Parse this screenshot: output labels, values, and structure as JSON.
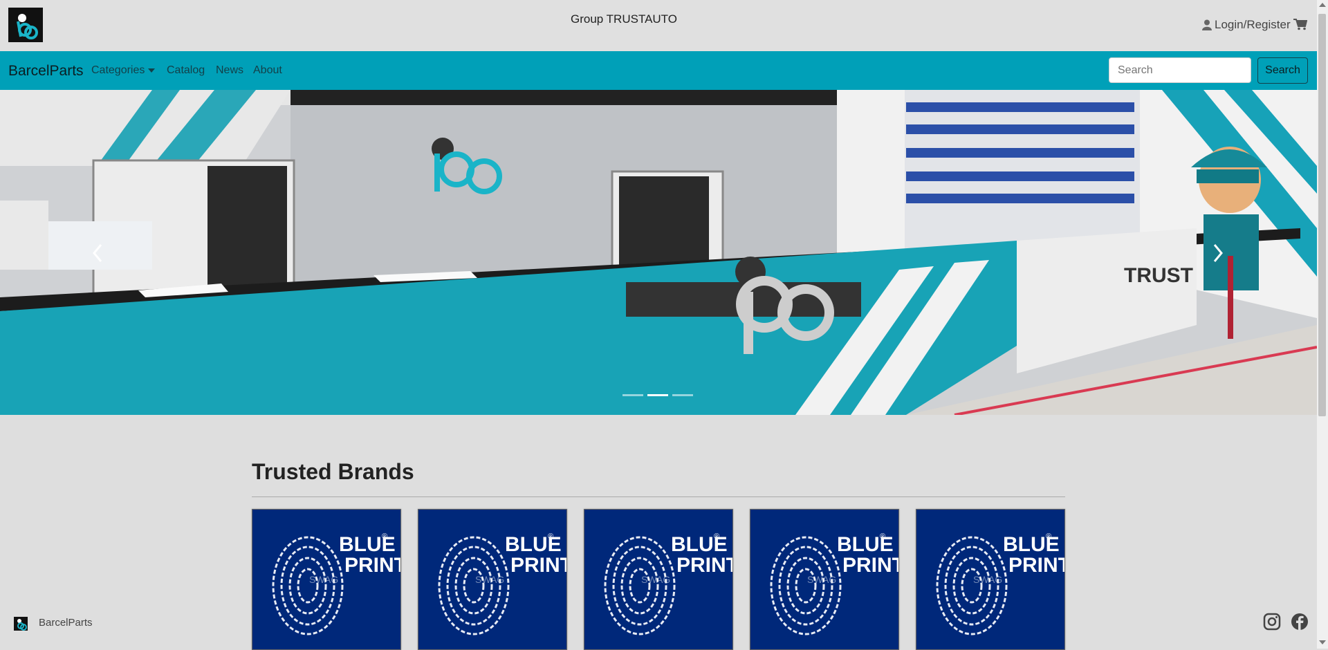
{
  "header": {
    "group_title": "Group TRUSTAUTO",
    "login_label": "Login/Register",
    "logo_icon": "bp-logo-icon",
    "user_icon": "user-icon",
    "cart_icon": "cart-icon"
  },
  "navbar": {
    "brand": "BarcelParts",
    "items": [
      {
        "label": "Categories",
        "has_dropdown": true
      },
      {
        "label": "Catalog"
      },
      {
        "label": "News"
      },
      {
        "label": "About"
      }
    ],
    "search": {
      "placeholder": "Search",
      "button_label": "Search"
    },
    "accent_color": "#00a0b8"
  },
  "hero": {
    "slide_count": 3,
    "active_slide": 2,
    "sign_text": "TRUST"
  },
  "brands": {
    "title": "Trusted Brands",
    "cards": [
      {
        "brand_line1": "BLUE",
        "brand_line2": "PRINT",
        "watermark": "SWAG",
        "mark": "®"
      },
      {
        "brand_line1": "BLUE",
        "brand_line2": "PRINT",
        "watermark": "SWAG",
        "mark": "®"
      },
      {
        "brand_line1": "BLUE",
        "brand_line2": "PRINT",
        "watermark": "SWAG",
        "mark": "®"
      },
      {
        "brand_line1": "BLUE",
        "brand_line2": "PRINT",
        "watermark": "SWAG",
        "mark": "®"
      },
      {
        "brand_line1": "BLUE",
        "brand_line2": "PRINT",
        "watermark": "SWAG",
        "mark": "®"
      }
    ],
    "card_color": "#00287a"
  },
  "footer": {
    "site_name": "BarcelParts",
    "social": [
      "instagram-icon",
      "facebook-icon"
    ]
  }
}
